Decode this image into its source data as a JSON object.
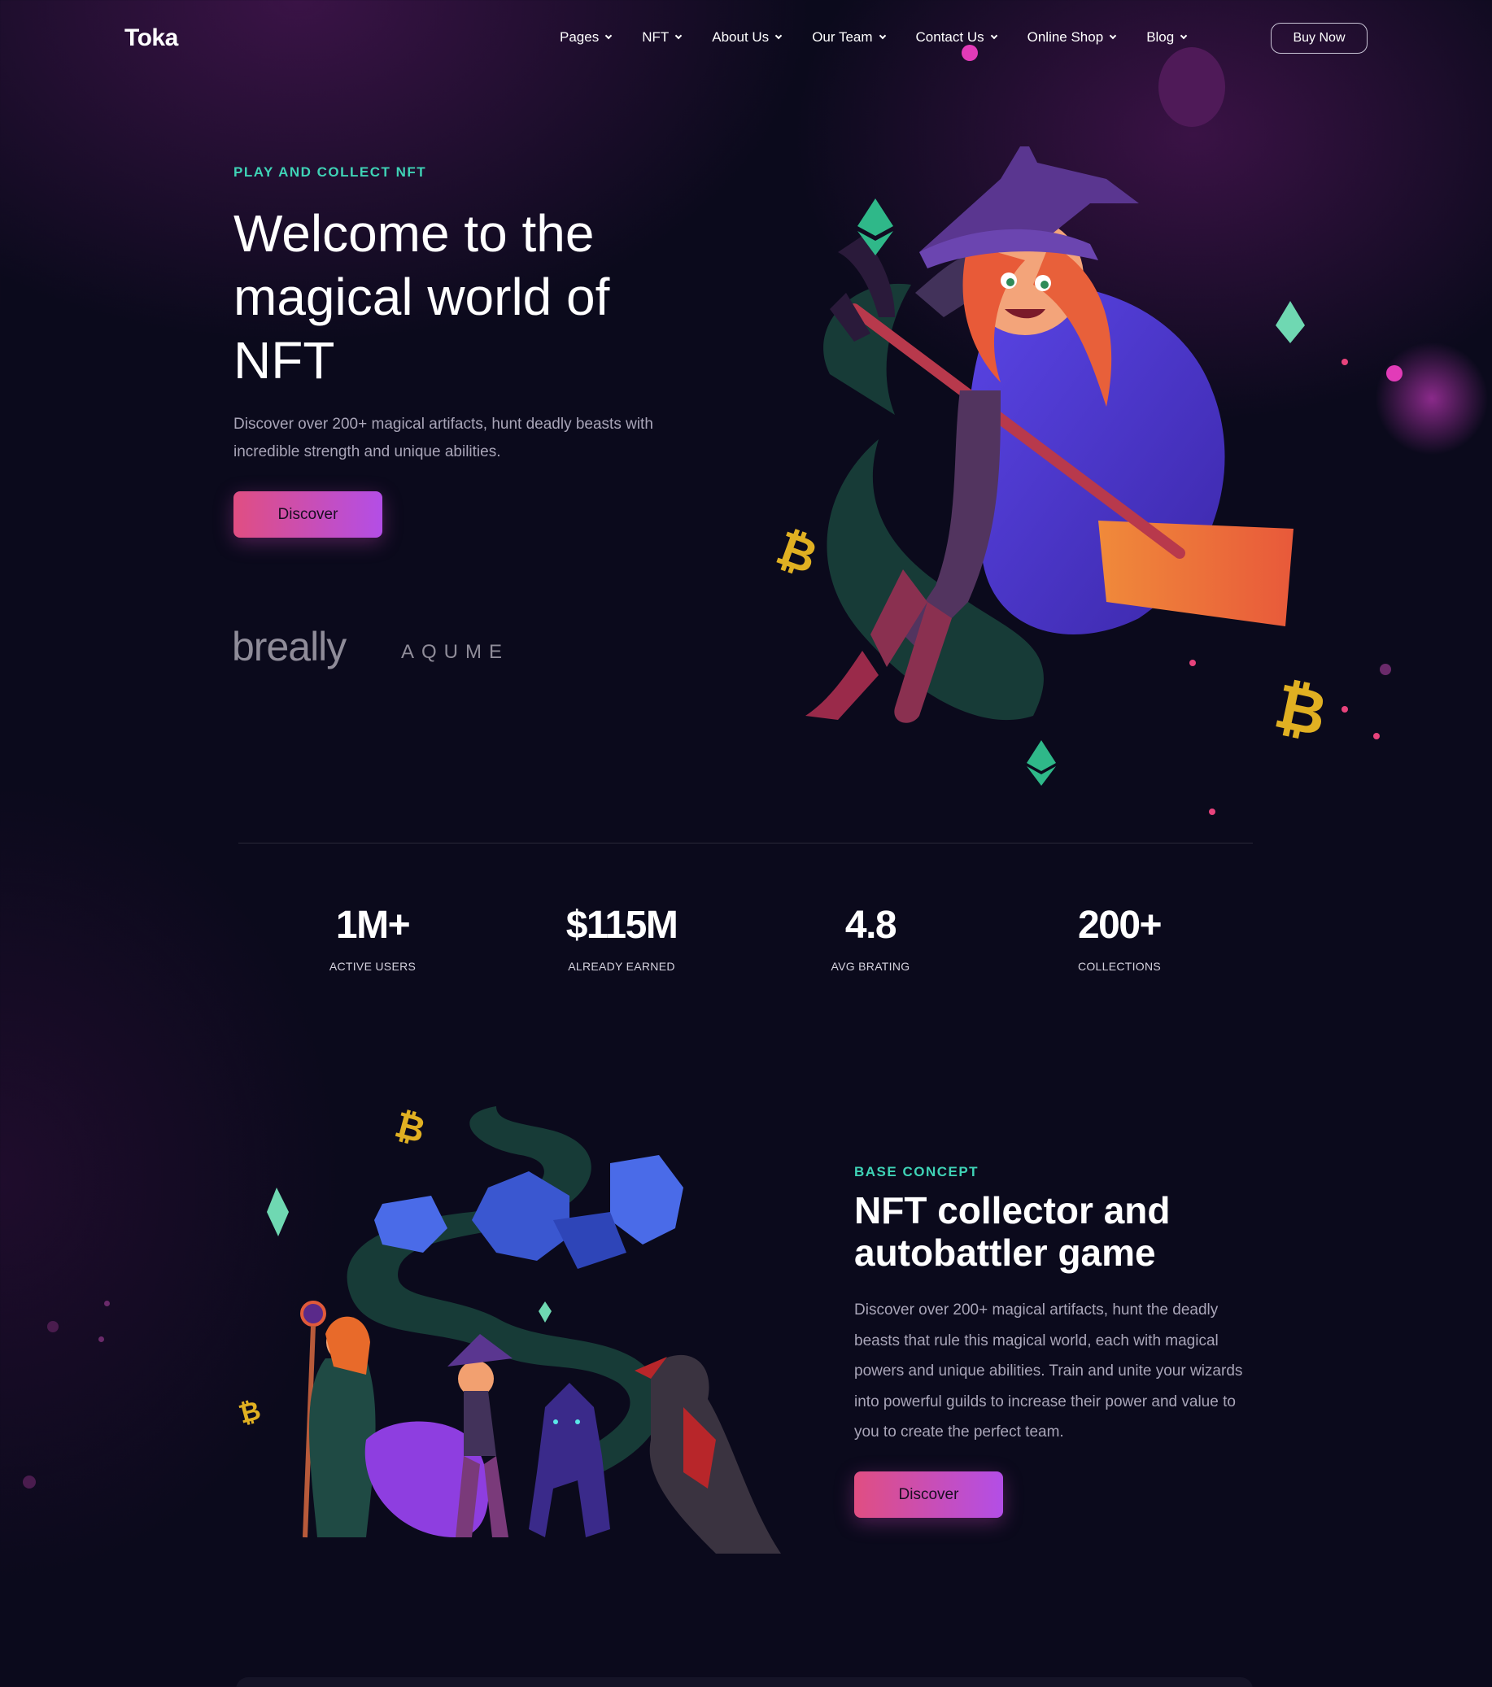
{
  "nav": {
    "logo": "Toka",
    "items": [
      {
        "label": "Pages"
      },
      {
        "label": "NFT"
      },
      {
        "label": "About Us"
      },
      {
        "label": "Our Team"
      },
      {
        "label": "Contact Us"
      },
      {
        "label": "Online Shop"
      },
      {
        "label": "Blog"
      }
    ],
    "cta": "Buy Now"
  },
  "hero": {
    "eyebrow": "PLAY AND COLLECT NFT",
    "title": "Welcome to the magical world of NFT",
    "text": "Discover over 200+ magical artifacts, hunt deadly beasts with incredible strength and unique abilities.",
    "button": "Discover",
    "partners": [
      "breally",
      "AQUME"
    ]
  },
  "stats": [
    {
      "value": "1M+",
      "label": "ACTIVE USERS"
    },
    {
      "value": "$115M",
      "label": "ALREADY EARNED"
    },
    {
      "value": "4.8",
      "label": "AVG BRATING"
    },
    {
      "value": "200+",
      "label": "COLLECTIONS"
    }
  ],
  "concept": {
    "eyebrow": "BASE CONCEPT",
    "title": "NFT collector and autobattler game",
    "text": "Discover over 200+ magical artifacts, hunt the deadly beasts that rule this magical world, each with magical powers and unique abilities. Train and unite your wizards into powerful guilds to increase their power and value to you to create the perfect team.",
    "button": "Discover"
  },
  "colors": {
    "accent_teal": "#3fd3b6",
    "button_gradient_start": "#e04e82",
    "button_gradient_end": "#b34ee6",
    "background": "#0b0a1c"
  }
}
